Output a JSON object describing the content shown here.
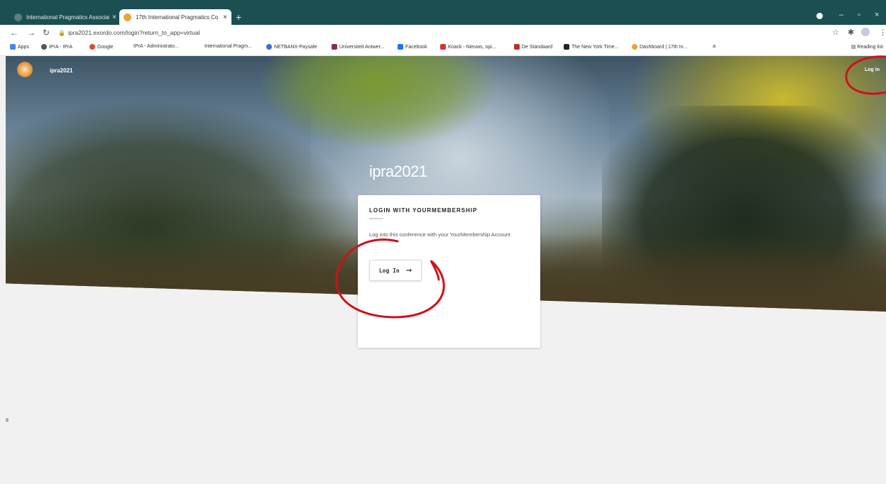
{
  "browser": {
    "tabs": [
      {
        "title": "International Pragmatics Associat",
        "active": false
      },
      {
        "title": "17th International Pragmatics Co",
        "active": true
      }
    ],
    "new_tab": "+",
    "controls": {
      "minimize": "–",
      "restore": "▫",
      "close": "×"
    },
    "url": "ipra2021.exordo.com/login?return_to_app=virtual",
    "bookmarks": [
      {
        "label": "Apps",
        "color": "#4285f4"
      },
      {
        "label": "IPrA - IPrA",
        "color": "#555555"
      },
      {
        "label": "Google",
        "color": "#ea4335"
      },
      {
        "label": "IPrA - Administrato...",
        "color": "#ffffff"
      },
      {
        "label": "International Pragm...",
        "color": "#ffffff"
      },
      {
        "label": "NETBANX-Paysafe",
        "color": "#3b6fd8"
      },
      {
        "label": "Universiteit Antwer...",
        "color": "#8a2b5e"
      },
      {
        "label": "Facebook",
        "color": "#1877f2"
      },
      {
        "label": "Knack - Nieuws, opi...",
        "color": "#d6312b"
      },
      {
        "label": "De Standaard",
        "color": "#c52a2a"
      },
      {
        "label": "The New York Time...",
        "color": "#222222"
      },
      {
        "label": "Dashboard | 17th In...",
        "color": "#e7a637"
      },
      {
        "label": "a",
        "color": "#ffffff"
      }
    ],
    "reading_list": "Reading list"
  },
  "page": {
    "site_name": "ipra2021",
    "header_login": "Log in",
    "hero_title": "ipra2021",
    "card": {
      "heading": "LOGIN WITH YOURMEMBERSHIP",
      "text": "Log into this conference with your YourMembership Account",
      "button_label": "Log In",
      "button_arrow": "→"
    },
    "stray_text": "s"
  },
  "colors": {
    "tab_strip": "#1b4f51",
    "annotation": "#d0101a"
  }
}
